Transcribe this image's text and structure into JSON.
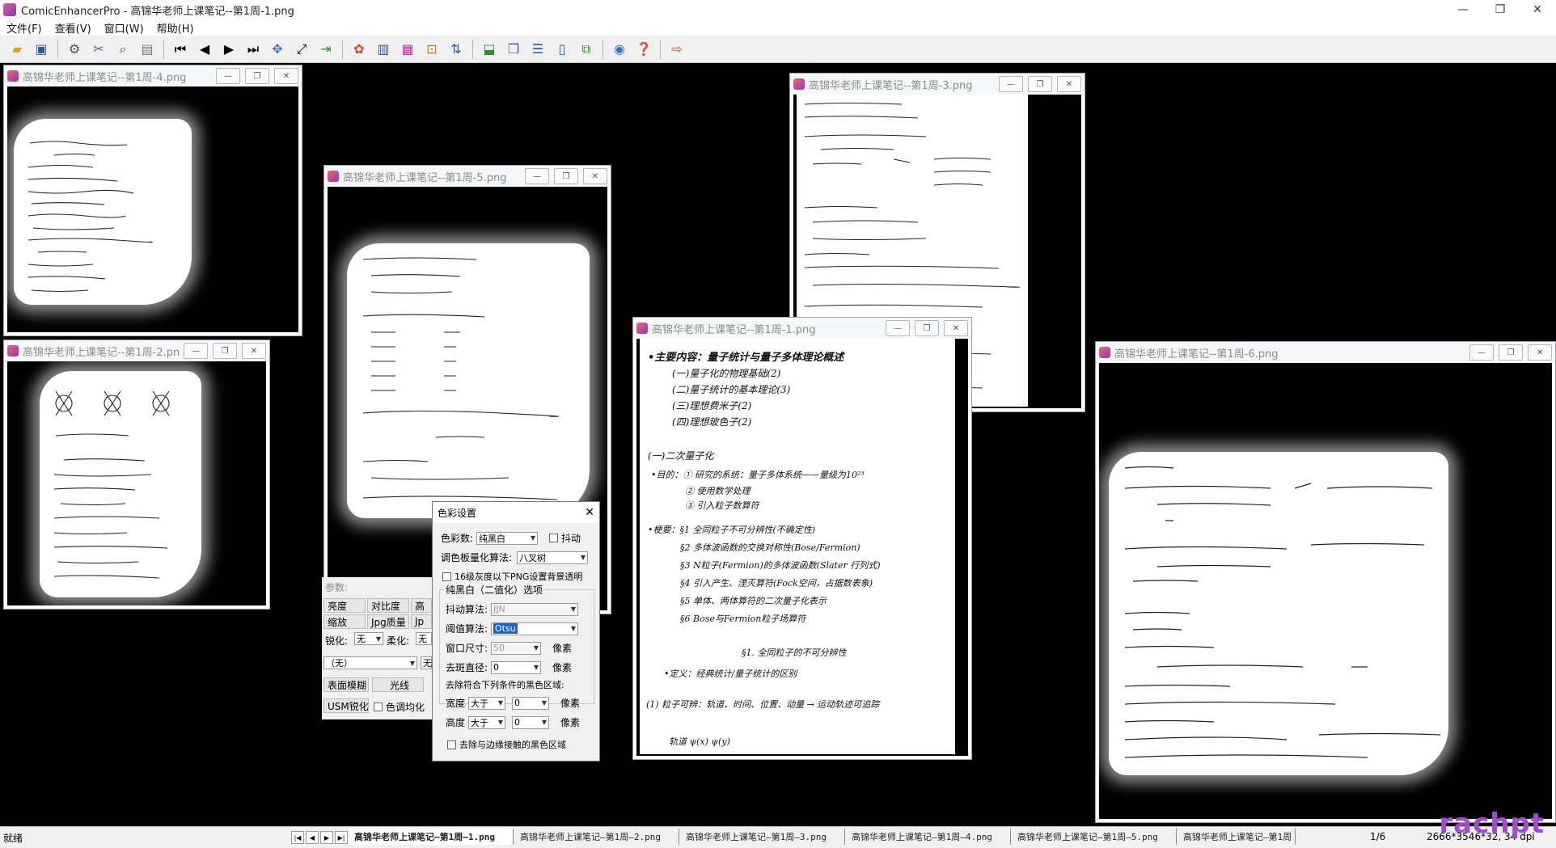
{
  "app": {
    "title": "ComicEnhancerPro - 高锦华老师上课笔记--第1周-1.png",
    "window_controls": [
      "—",
      "❐",
      "✕"
    ]
  },
  "menu": [
    "文件(F)",
    "查看(V)",
    "窗口(W)",
    "帮助(H)"
  ],
  "toolbar_icons": [
    "open-folder",
    "save",
    "batch",
    "cut",
    "find",
    "clipboard",
    "first",
    "prev",
    "next",
    "last",
    "fit",
    "zoom-fit",
    "export",
    "color",
    "levels",
    "palette",
    "crop",
    "sort",
    "output",
    "compare",
    "split-h",
    "split-v",
    "convert",
    "about",
    "help",
    "exit"
  ],
  "windows": {
    "w4": {
      "title": "高锦华老师上课笔记--第1周-4.png"
    },
    "w2": {
      "title": "高锦华老师上课笔记--第1周-2.png"
    },
    "w5": {
      "title": "高锦华老师上课笔记--第1周-5.png"
    },
    "w3": {
      "title": "高锦华老师上课笔记--第1周-3.png"
    },
    "w1": {
      "title": "高锦华老师上课笔记--第1周-1.png"
    },
    "w6": {
      "title": "高锦华老师上课笔记--第1周-6.png"
    }
  },
  "note1": {
    "lines": [
      "•主要内容：量子统计与量子多体理论概述",
      "(一)量子化的物理基础(2)",
      "(二)量子统计的基本理论(3)",
      "(三)理想费米子(2)",
      "(四)理想玻色子(2)",
      "(一)二次量子化",
      "•目的：① 研究的系统：量子多体系统——量级为10²³",
      "② 使用数学处理",
      "③ 引入粒子数算符",
      "•梗要：§1 全同粒子不可分辨性(不确定性)",
      "§2 多体波函数的交换对称性(Bose/Fermion)",
      "§3 N粒子(Fermion)的多体波函数(Slater 行列式)",
      "§4 引入产生、湮灭算符(Fock空间，占据数表象)",
      "§5 单体、两体算符的二次量子化表示",
      "§6 Bose与Fermion粒子场算符",
      "§1. 全同粒子的不可分辨性",
      "•定义：经典统计/量子统计的区别",
      "(1) 粒子可辨：轨道、时间、位置、动量 → 运动轨迹可追踪",
      "轨道 ψ(x) ψ(y)"
    ]
  },
  "dialog": {
    "title": "色彩设置",
    "close": "✕",
    "color_count_label": "色彩数:",
    "color_count_value": "纯黑白",
    "dither_label": "抖动",
    "palette_algo_label": "调色板量化算法:",
    "palette_algo_value": "八叉树",
    "gray16_label": "16级灰度以下PNG设置背景透明",
    "group_label": "纯黑白（二值化）选项",
    "dither_algo_label": "抖动算法:",
    "dither_algo_value": "JJN",
    "threshold_algo_label": "阈值算法:",
    "threshold_algo_value": "Otsu",
    "window_size_label": "窗口尺寸:",
    "window_size_value": "50",
    "despeckle_label": "去斑直径:",
    "despeckle_value": "0",
    "unit_px": "像素",
    "remove_region_label": "去除符合下列条件的黑色区域:",
    "width_label": "宽度",
    "height_label": "高度",
    "cond_value": "大于",
    "width_value": "0",
    "height_value": "0",
    "edge_label": "去除与边缘接触的黑色区域"
  },
  "panel": {
    "params_label": "参数:",
    "brightness": "亮度",
    "contrast": "对比度",
    "high": "高",
    "scale": "缩放",
    "jpg_quality": "Jpg质量",
    "jp": "Jp",
    "sharpen_label": "锐化:",
    "sharpen_value": "无",
    "soften_label": "柔化:",
    "soften_value": "无",
    "none_combo": "（无）",
    "none_combo2": "无",
    "surface_blur": "表面模糊",
    "light": "光线",
    "usm": "USM锐化",
    "tone_even": "色调均化"
  },
  "status": {
    "ready": "就绪",
    "tabs": [
      "高锦华老师上课笔记—第1周—1.png",
      "高锦华老师上课笔记—第1周—2.png",
      "高锦华老师上课笔记—第1周—3.png",
      "高锦华老师上课笔记—第1周—4.png",
      "高锦华老师上课笔记—第1周—5.png",
      "高锦华老师上课笔记—第1周"
    ],
    "page": "1/6",
    "image_info": "2666*3546*32, 34",
    "dpi": "dpi",
    "watermark": "rachpt"
  }
}
